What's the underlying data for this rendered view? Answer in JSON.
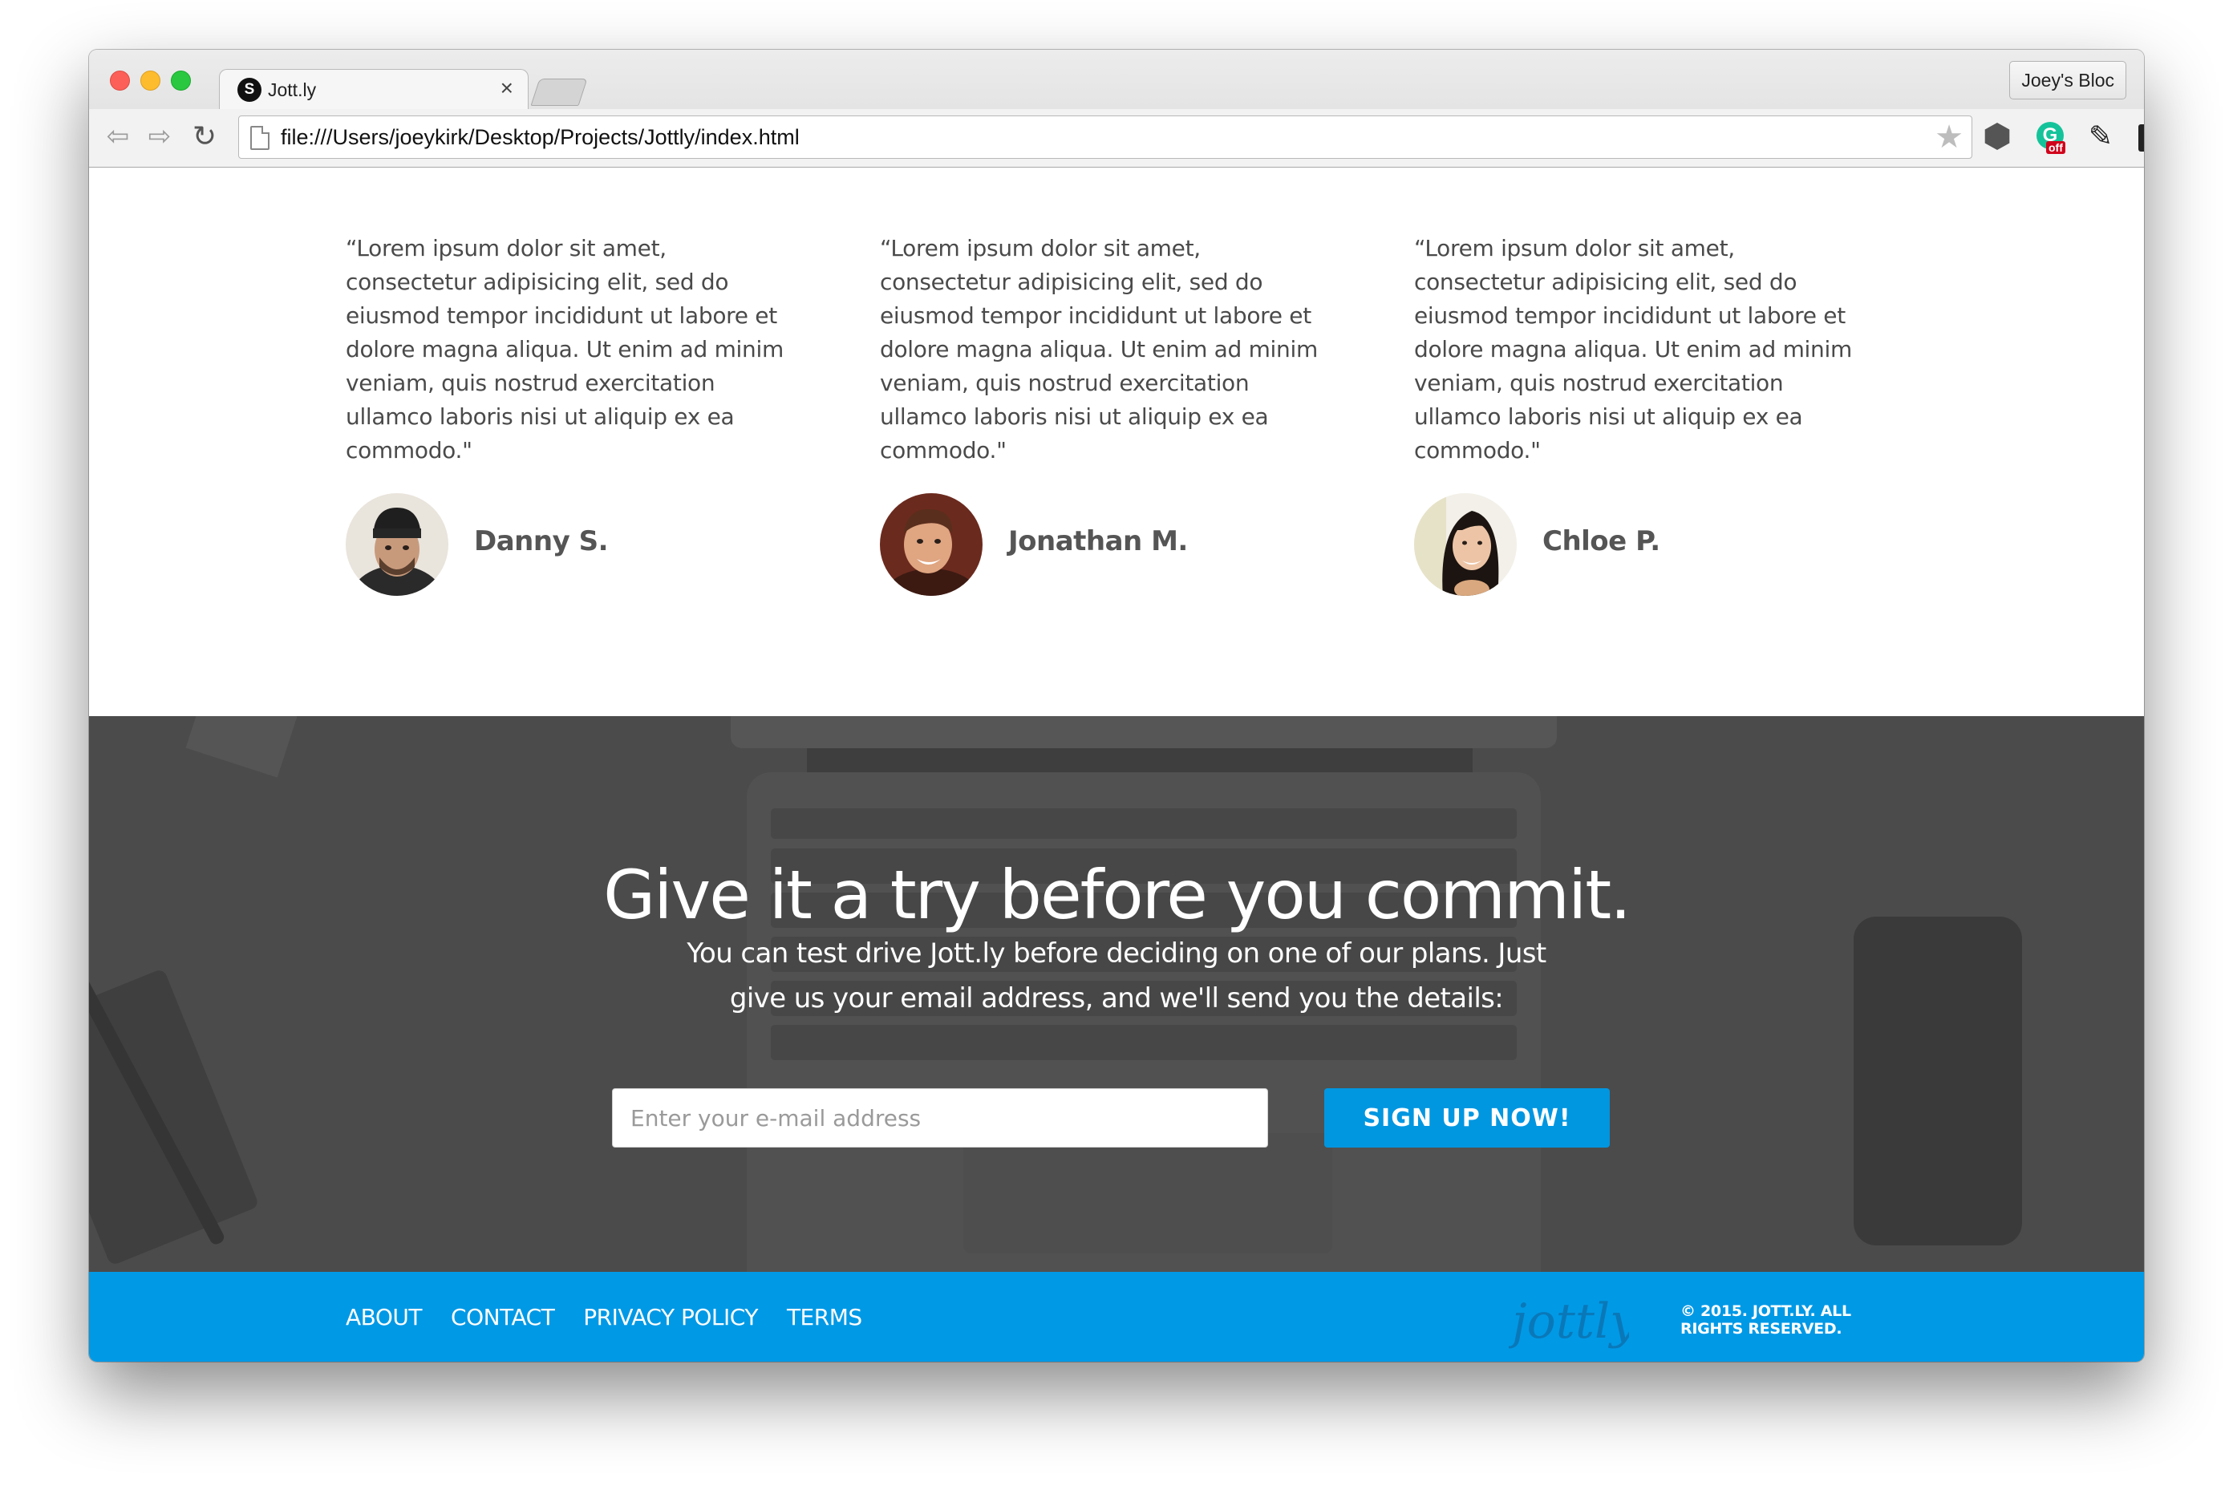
{
  "browser": {
    "tab_title": "Jott.ly",
    "tab_close": "×",
    "favicon_letter": "S",
    "profile_name": "Joey's Bloc",
    "url": "file:///Users/joeykirk/Desktop/Projects/Jottly/index.html",
    "icons": {
      "back": "arrow-left-icon",
      "forward": "arrow-right-icon",
      "reload": "reload-icon",
      "star": "star-icon",
      "extension_hex": "hexagon-extension-icon",
      "extension_grammarly": "grammarly-icon",
      "grammarly_badge": "off",
      "extension_edit": "edit-icon",
      "extension_b": "bold-b-extension-icon",
      "menu": "hamburger-menu-icon"
    }
  },
  "testimonials": [
    {
      "quote": "“Lorem ipsum dolor sit amet, consectetur adipisicing elit, sed do eiusmod tempor incididunt ut labore et dolore magna aliqua. Ut enim ad minim veniam, quis nostrud exercitation ullamco laboris nisi ut aliquip ex ea commodo.\"",
      "name": "Danny S."
    },
    {
      "quote": "“Lorem ipsum dolor sit amet, consectetur adipisicing elit, sed do eiusmod tempor incididunt ut labore et dolore magna aliqua. Ut enim ad minim veniam, quis nostrud exercitation ullamco laboris nisi ut aliquip ex ea commodo.\"",
      "name": "Jonathan M."
    },
    {
      "quote": "“Lorem ipsum dolor sit amet, consectetur adipisicing elit, sed do eiusmod tempor incididunt ut labore et dolore magna aliqua. Ut enim ad minim veniam, quis nostrud exercitation ullamco laboris nisi ut aliquip ex ea commodo.\"",
      "name": "Chloe P."
    }
  ],
  "cta": {
    "title": "Give it a try before you commit.",
    "description": "You can test drive Jott.ly before deciding on one of our plans. Just give us your email address, and we'll send you the details:",
    "email_placeholder": "Enter your e-mail address",
    "button_label": "SIGN UP NOW!"
  },
  "footer": {
    "links": [
      "ABOUT",
      "CONTACT",
      "PRIVACY POLICY",
      "TERMS"
    ],
    "logo_text": "jottly",
    "copyright_line1": "© 2015. JOTT.LY. ALL",
    "copyright_line2": "RIGHTS RESERVED."
  },
  "colors": {
    "accent": "#0099e6",
    "button": "#0096e0",
    "cta_overlay": "#4a4a4a",
    "text": "#4a4a4a"
  }
}
